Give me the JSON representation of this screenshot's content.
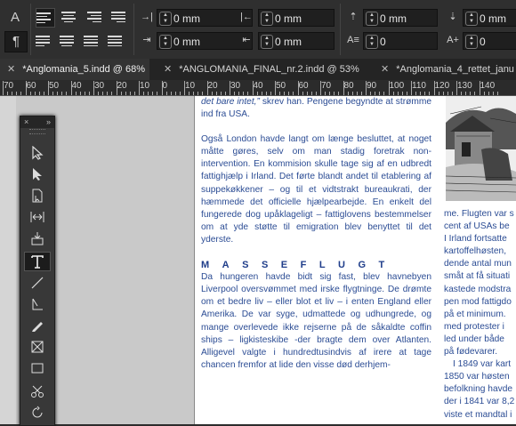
{
  "control_panel": {
    "char_mode_icon": "A",
    "para_mode_icon": "¶",
    "fields": [
      {
        "name": "left-indent-field",
        "value": "0 mm"
      },
      {
        "name": "right-indent-field",
        "value": "0 mm"
      },
      {
        "name": "space-before-field",
        "value": "0 mm"
      },
      {
        "name": "space-before-2-field",
        "value": "0 mm"
      },
      {
        "name": "first-line-indent-field",
        "value": "0 mm"
      },
      {
        "name": "last-line-indent-field",
        "value": "0 mm"
      },
      {
        "name": "drop-cap-lines-field",
        "value": "0"
      },
      {
        "name": "drop-cap-chars-field",
        "value": "0"
      }
    ]
  },
  "tabs": [
    {
      "label": "*Anglomania_5.indd @ 68%",
      "active": true
    },
    {
      "label": "*ANGLOMANIA_FINAL_nr.2.indd @ 53%",
      "active": false
    },
    {
      "label": "*Anglomania_4_rettet_janu",
      "active": false
    }
  ],
  "ruler": {
    "labels": [
      "70",
      "60",
      "50",
      "40",
      "30",
      "20",
      "10",
      "0",
      "10",
      "20",
      "30",
      "40",
      "50",
      "60",
      "70",
      "80",
      "90",
      "100",
      "110",
      "120",
      "130",
      "140"
    ]
  },
  "document": {
    "col1": {
      "p0_italic": "det bare intet,”",
      "p0_rest": " skrev han. Pengene begyndte at strømme ind fra USA.",
      "p1": "Også London havde langt om længe besluttet, at noget måtte gøres, selv om man stadig foretrak non-intervention. En kommision skulle tage sig af en udbredt fattighjælp i Irland. Det førte blandt andet til etablering af suppekøkkener – og til et vidtstrakt bureaukrati, der hæmmede det officielle hjælpearbejde. En enkelt del fungerede dog upåklageligt – fattiglovens bestemmelser om at yde støtte til emigration blev benyttet til det yderste.",
      "heading": "MASSEFLUGT",
      "p2": "Da hungeren havde bidt sig fast, blev havnebyen Liverpool oversvømmet med irske flygtninge. De drømte om et bedre liv – eller blot et liv – i enten England eller Amerika. De var syge, udmattede og udhungrede, og mange overlevede ikke rejserne på de såkaldte coffin ships – ligkisteskibe -der bragte dem over Atlanten. Alligevel valgte i hundredtusindvis af irere at tage chancen fremfor at lide den visse død derhjem-"
    },
    "col2": {
      "lines": [
        "me. Flugten var s",
        "cent af USAs be",
        "I Irland fortsatte",
        "kartoffelhøsten, ",
        "dende antal mun",
        "småt at få situati",
        "kastede modstra",
        "pen mod fattigdo",
        "på et minimum. ",
        "med protester i",
        "led under både",
        "på fødevarer.",
        "I 1849 var kart",
        "1850 var høsten ",
        "befolkning havde",
        "der i 1841 var 8,2",
        "viste et mandtal i"
      ]
    }
  },
  "toolbox": {
    "header_close": "×",
    "header_collapse": "»"
  }
}
